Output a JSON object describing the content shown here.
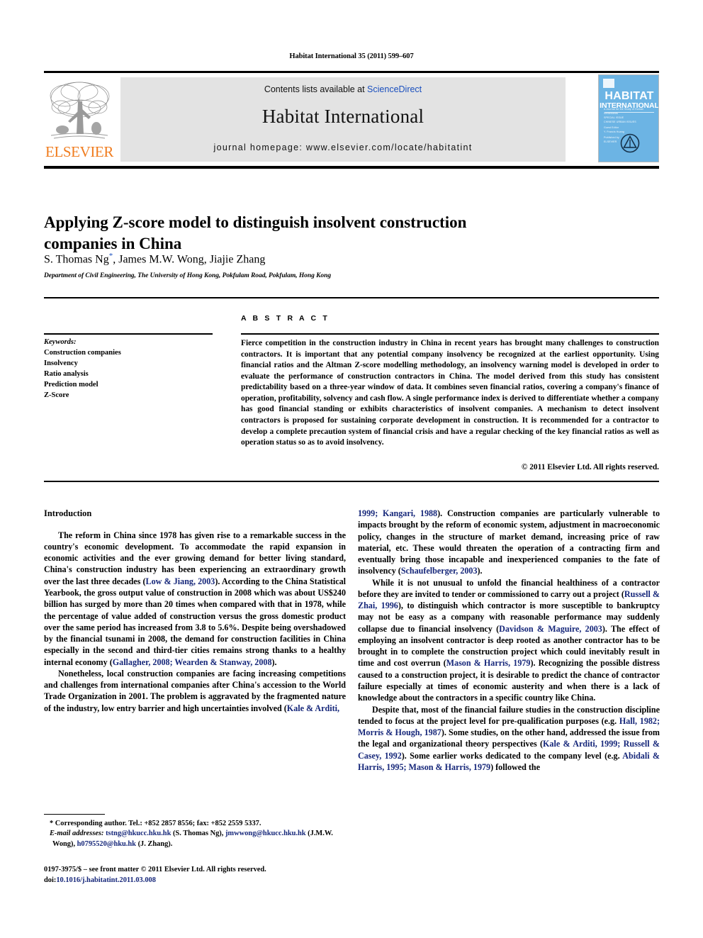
{
  "running_head": "Habitat International 35 (2011) 599–607",
  "masthead": {
    "contents_prefix": "Contents lists available at ",
    "sciencedirect": "ScienceDirect",
    "journal_title": "Habitat International",
    "homepage": "journal homepage: www.elsevier.com/locate/habitatint",
    "publisher_name": "ELSEVIER",
    "cover": {
      "line1": "HABITAT",
      "line2": "INTERNATIONAL",
      "tagline": "A Journal for the Study of Human Settlements",
      "block1": "SPECIAL ISSUE\nCHINESE URBAN ISSUES",
      "block2": "Guest Editor\nY. Francis Huang",
      "block3": "Published by\nELSEVIER"
    }
  },
  "article": {
    "title": "Applying Z-score model to distinguish insolvent construction companies in China",
    "authors": "S. Thomas Ng",
    "authors_rest": ", James M.W. Wong, Jiajie Zhang",
    "corresponding_mark": "*",
    "affiliation": "Department of Civil Engineering, The University of Hong Kong, Pokfulam Road, Pokfulam, Hong Kong"
  },
  "abstract": {
    "heading": "A B S T R A C T",
    "text": "Fierce competition in the construction industry in China in recent years has brought many challenges to construction contractors. It is important that any potential company insolvency be recognized at the earliest opportunity. Using financial ratios and the Altman Z-score modelling methodology, an insolvency warning model is developed in order to evaluate the performance of construction contractors in China. The model derived from this study has consistent predictability based on a three-year window of data. It combines seven financial ratios, covering a company's finance of operation, profitability, solvency and cash flow. A single performance index is derived to differentiate whether a company has good financial standing or exhibits characteristics of insolvent companies. A mechanism to detect insolvent contractors is proposed for sustaining corporate development in construction. It is recommended for a contractor to develop a complete precaution system of financial crisis and have a regular checking of the key financial ratios as well as operation status so as to avoid insolvency.",
    "copyright": "© 2011 Elsevier Ltd. All rights reserved."
  },
  "keywords": {
    "heading": "Keywords:",
    "items": [
      "Construction companies",
      "Insolvency",
      "Ratio analysis",
      "Prediction model",
      "Z-Score"
    ]
  },
  "body": {
    "section_heading": "Introduction",
    "left_paragraphs": [
      {
        "parts": [
          {
            "t": "The reform in China since 1978 has given rise to a remarkable success in the country's economic development. To accommodate the rapid expansion in economic activities and the ever growing demand for better living standard, China's construction industry has been experiencing an extraordinary growth over the last three decades (",
            "cite": false
          },
          {
            "t": "Low & Jiang, 2003",
            "cite": true
          },
          {
            "t": "). According to the China Statistical Yearbook, the gross output value of construction in 2008 which was about US$240 billion has surged by more than 20 times when compared with that in 1978, while the percentage of value added of construction versus the gross domestic product over the same period has increased from 3.8 to 5.6%. Despite being overshadowed by the financial tsunami in 2008, the demand for construction facilities in China especially in the second and third-tier cities remains strong thanks to a healthy internal economy (",
            "cite": false
          },
          {
            "t": "Gallagher, 2008; Wearden & Stanway, 2008",
            "cite": true
          },
          {
            "t": ").",
            "cite": false
          }
        ]
      },
      {
        "parts": [
          {
            "t": "Nonetheless, local construction companies are facing increasing competitions and challenges from international companies after China's accession to the World Trade Organization in 2001. The problem is aggravated by the fragmented nature of the industry, low entry barrier and high uncertainties involved (",
            "cite": false
          },
          {
            "t": "Kale & Arditi,",
            "cite": true
          }
        ]
      }
    ],
    "right_paragraphs": [
      {
        "parts": [
          {
            "t": "1999; Kangari, 1988",
            "cite": true
          },
          {
            "t": "). Construction companies are particularly vulnerable to impacts brought by the reform of economic system, adjustment in macroeconomic policy, changes in the structure of market demand, increasing price of raw material, etc. These would threaten the operation of a contracting firm and eventually bring those incapable and inexperienced companies to the fate of insolvency (",
            "cite": false
          },
          {
            "t": "Schaufelberger, 2003",
            "cite": true
          },
          {
            "t": ").",
            "cite": false
          }
        ]
      },
      {
        "parts": [
          {
            "t": "While it is not unusual to unfold the financial healthiness of a contractor before they are invited to tender or commissioned to carry out a project (",
            "cite": false
          },
          {
            "t": "Russell & Zhai, 1996",
            "cite": true
          },
          {
            "t": "), to distinguish which contractor is more susceptible to bankruptcy may not be easy as a company with reasonable performance may suddenly collapse due to financial insolvency (",
            "cite": false
          },
          {
            "t": "Davidson & Maguire, 2003",
            "cite": true
          },
          {
            "t": "). The effect of employing an insolvent contractor is deep rooted as another contractor has to be brought in to complete the construction project which could inevitably result in time and cost overrun (",
            "cite": false
          },
          {
            "t": "Mason & Harris, 1979",
            "cite": true
          },
          {
            "t": "). Recognizing the possible distress caused to a construction project, it is desirable to predict the chance of contractor failure especially at times of economic austerity and when there is a lack of knowledge about the contractors in a specific country like China.",
            "cite": false
          }
        ]
      },
      {
        "parts": [
          {
            "t": "Despite that, most of the financial failure studies in the construction discipline tended to focus at the project level for pre-qualification purposes (e.g. ",
            "cite": false
          },
          {
            "t": "Hall, 1982; Morris & Hough, 1987",
            "cite": true
          },
          {
            "t": "). Some studies, on the other hand, addressed the issue from the legal and organizational theory perspectives (",
            "cite": false
          },
          {
            "t": "Kale & Arditi, 1999; Russell & Casey, 1992",
            "cite": true
          },
          {
            "t": "). Some earlier works dedicated to the company level (e.g. ",
            "cite": false
          },
          {
            "t": "Abidali & Harris, 1995; Mason & Harris, 1979",
            "cite": true
          },
          {
            "t": ") followed the",
            "cite": false
          }
        ]
      }
    ]
  },
  "footnote": {
    "corresponding": "* Corresponding author. Tel.: +852 2857 8556; fax: +852 2559 5337.",
    "email_label": "E-mail addresses:",
    "email1": "tstng@hkucc.hku.hk",
    "email1_owner": " (S. Thomas Ng), ",
    "email2": "jmwwong@hkucc.hku.hk",
    "email2_owner": " (J.M.W. Wong), ",
    "email3": "h0795520@hku.hk",
    "email3_owner": " (J. Zhang)."
  },
  "imprint": {
    "issn_line": "0197-3975/$ – see front matter © 2011 Elsevier Ltd. All rights reserved.",
    "doi_prefix": "doi:",
    "doi_value": "10.1016/j.habitatint.2011.03.008"
  }
}
